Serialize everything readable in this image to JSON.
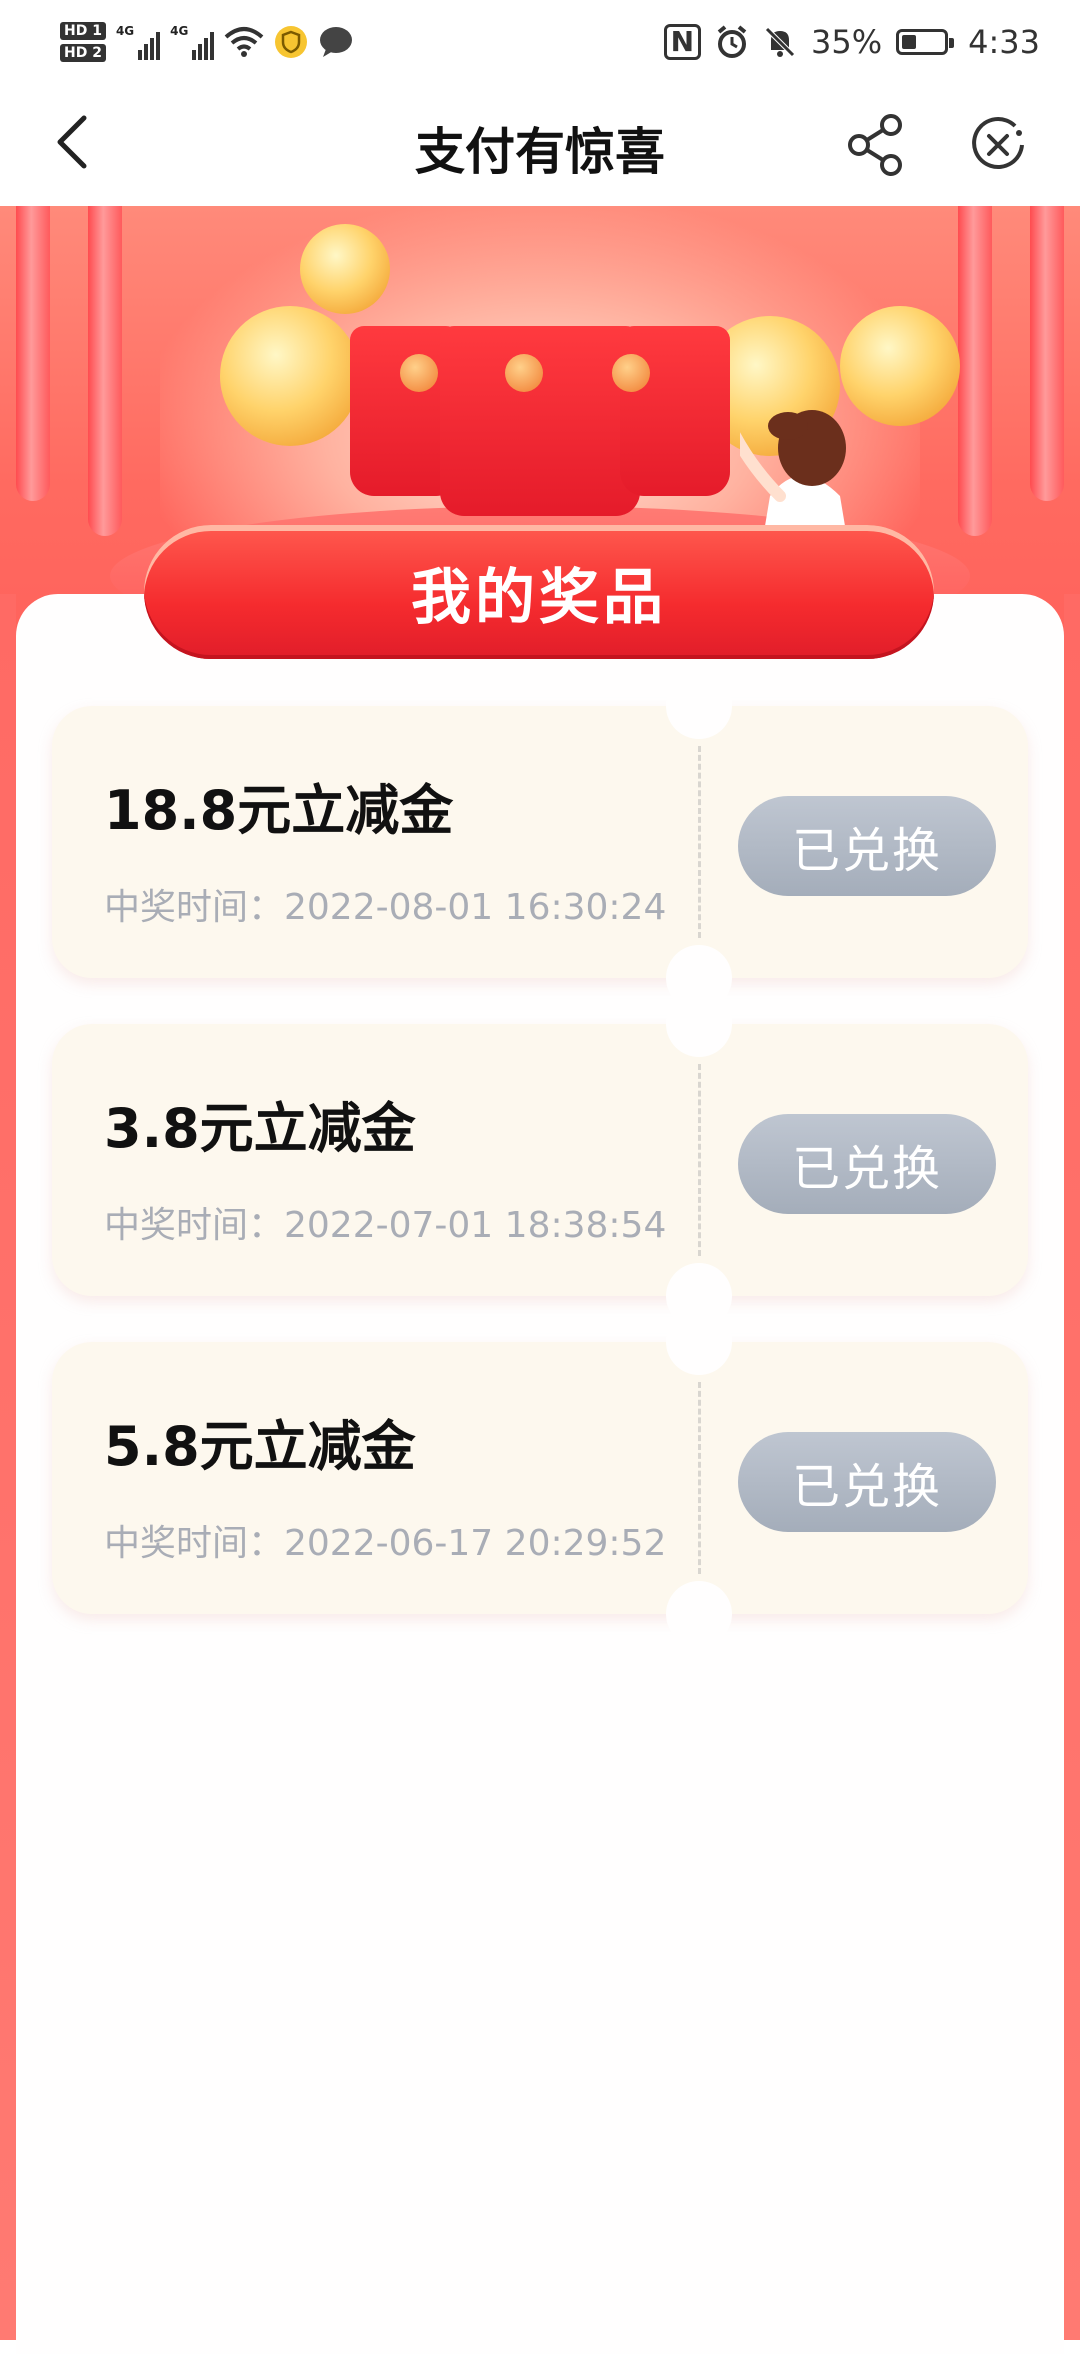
{
  "status_bar": {
    "hd1": "HD 1",
    "hd2": "HD 2",
    "signal1_label": "4G",
    "signal2_label": "4G",
    "battery_percent": "35%",
    "battery_level": 0.35,
    "time": "4:33"
  },
  "nav": {
    "title": "支付有惊喜"
  },
  "section": {
    "header": "我的奖品"
  },
  "prizes": [
    {
      "title": "18.8元立减金",
      "time": "中奖时间：2022-08-01 16:30:24",
      "button": "已兑换"
    },
    {
      "title": "3.8元立减金",
      "time": "中奖时间：2022-07-01 18:38:54",
      "button": "已兑换"
    },
    {
      "title": "5.8元立减金",
      "time": "中奖时间：2022-06-17 20:29:52",
      "button": "已兑换"
    }
  ],
  "colors": {
    "accent_red": "#f52b2e",
    "ticket_bg": "#fdf8ee",
    "redeemed_button": "#aab2be"
  }
}
